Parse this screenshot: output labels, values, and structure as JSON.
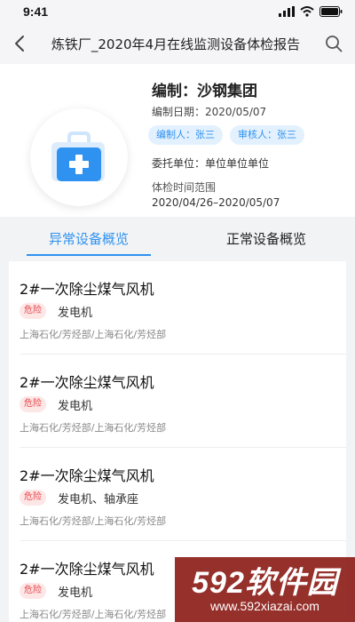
{
  "status": {
    "time": "9:41"
  },
  "nav": {
    "title": "炼铁厂_2020年4月在线监测设备体检报告"
  },
  "report": {
    "author": "编制：沙钢集团",
    "date": "编制日期：2020/05/07",
    "compiler_chip": "编制人：张三",
    "reviewer_chip": "审核人：张三",
    "client": "委托单位：单位单位单位",
    "range_label": "体检时间范围",
    "range_value": "2020/04/26–2020/05/07"
  },
  "tabs": [
    {
      "label": "异常设备概览",
      "active": true
    },
    {
      "label": "正常设备概览",
      "active": false
    }
  ],
  "items": [
    {
      "title": "2#一次除尘煤气风机",
      "badge": "危险",
      "parts": "发电机",
      "path": "上海石化/芳烃部/上海石化/芳烃部"
    },
    {
      "title": "2#一次除尘煤气风机",
      "badge": "危险",
      "parts": "发电机",
      "path": "上海石化/芳烃部/上海石化/芳烃部"
    },
    {
      "title": "2#一次除尘煤气风机",
      "badge": "危险",
      "parts": "发电机、轴承座",
      "path": "上海石化/芳烃部/上海石化/芳烃部"
    },
    {
      "title": "2#一次除尘煤气风机",
      "badge": "危险",
      "parts": "发电机",
      "path": "上海石化/芳烃部/上海石化/芳烃部"
    }
  ],
  "watermark": {
    "brand": "592软件园",
    "url": "www.592xiazai.com"
  },
  "colors": {
    "accent": "#2f92f0",
    "danger": "#e8474b",
    "danger_bg": "#fde6e6",
    "chip_bg": "#e3f1fe"
  },
  "icons": {
    "back": "chevron-left-icon",
    "search": "search-icon",
    "report": "medical-kit-icon"
  }
}
